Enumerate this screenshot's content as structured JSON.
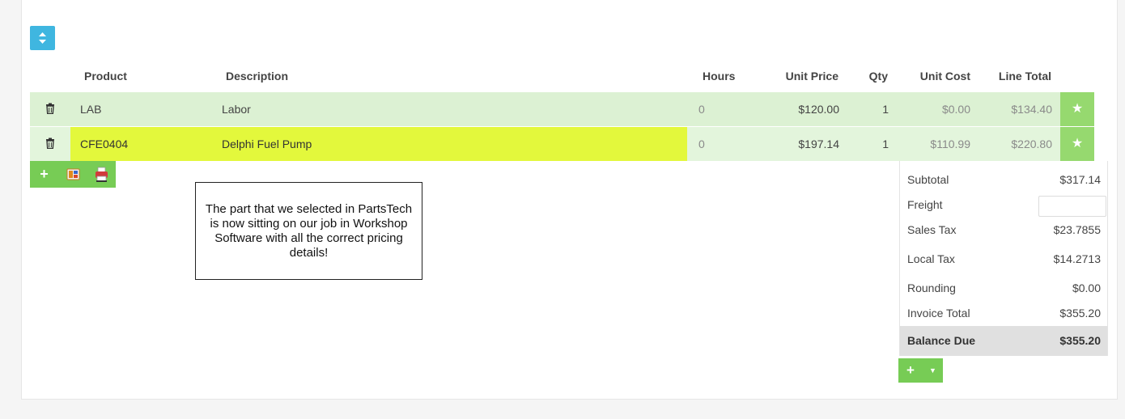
{
  "toolbar": {
    "sort_icon": "sort-updown-icon"
  },
  "table": {
    "headers": {
      "product": "Product",
      "description": "Description",
      "hours": "Hours",
      "unit_price": "Unit Price",
      "qty": "Qty",
      "unit_cost": "Unit Cost",
      "line_total": "Line Total"
    },
    "rows": [
      {
        "product": "LAB",
        "description": "Labor",
        "hours": "0",
        "unit_price": "$120.00",
        "qty": "1",
        "unit_cost": "$0.00",
        "line_total": "$134.40"
      },
      {
        "product": "CFE0404",
        "description": "Delphi Fuel Pump",
        "hours": "0",
        "unit_price": "$197.14",
        "qty": "1",
        "unit_cost": "$110.99",
        "line_total": "$220.80"
      }
    ]
  },
  "callout": {
    "text": "The part that we selected in PartsTech is now sitting on our job in Workshop Software with all the correct pricing details!"
  },
  "totals": {
    "subtotal_label": "Subtotal",
    "subtotal": "$317.14",
    "freight_label": "Freight",
    "freight": "",
    "sales_tax_label": "Sales Tax",
    "sales_tax": "$23.7855",
    "local_tax_label": "Local Tax",
    "local_tax": "$14.2713",
    "rounding_label": "Rounding",
    "rounding": "$0.00",
    "invoice_total_label": "Invoice Total",
    "invoice_total": "$355.20",
    "balance_due_label": "Balance Due",
    "balance_due": "$355.20"
  },
  "colors": {
    "row_green": "#dcf1d3",
    "highlight_yellow": "#e3f83c",
    "action_green": "#77cc55",
    "sort_blue": "#3fb6e0"
  }
}
